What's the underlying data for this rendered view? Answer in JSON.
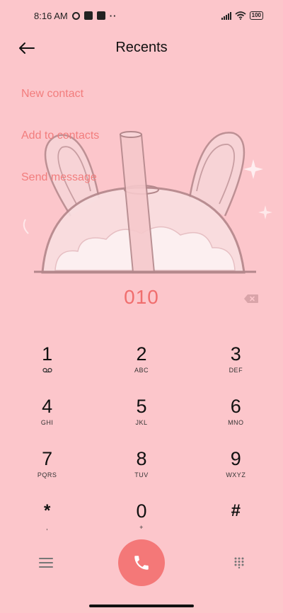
{
  "status_bar": {
    "time": "8:16 AM",
    "dots": "··",
    "battery": "100",
    "icons": [
      "pinwheel-icon",
      "square-app-icon",
      "upload-icon",
      "signal-icon",
      "wifi-icon",
      "battery-icon"
    ]
  },
  "header": {
    "title": "Recents",
    "back_icon": "arrow-left-icon"
  },
  "actions": {
    "new_contact": "New contact",
    "add_to_contacts": "Add to contacts",
    "send_message": "Send message"
  },
  "dial": {
    "number": "010"
  },
  "keypad": [
    [
      {
        "digit": "1",
        "letters": ""
      },
      {
        "digit": "2",
        "letters": "ABC"
      },
      {
        "digit": "3",
        "letters": "DEF"
      }
    ],
    [
      {
        "digit": "4",
        "letters": "GHI"
      },
      {
        "digit": "5",
        "letters": "JKL"
      },
      {
        "digit": "6",
        "letters": "MNO"
      }
    ],
    [
      {
        "digit": "7",
        "letters": "PQRS"
      },
      {
        "digit": "8",
        "letters": "TUV"
      },
      {
        "digit": "9",
        "letters": "WXYZ"
      }
    ],
    [
      {
        "digit": "*",
        "letters": ","
      },
      {
        "digit": "0",
        "letters": "+"
      },
      {
        "digit": "#",
        "letters": ""
      }
    ]
  ],
  "colors": {
    "background": "#fcc6cb",
    "accent": "#f27d7d",
    "call_button": "#f47878"
  }
}
